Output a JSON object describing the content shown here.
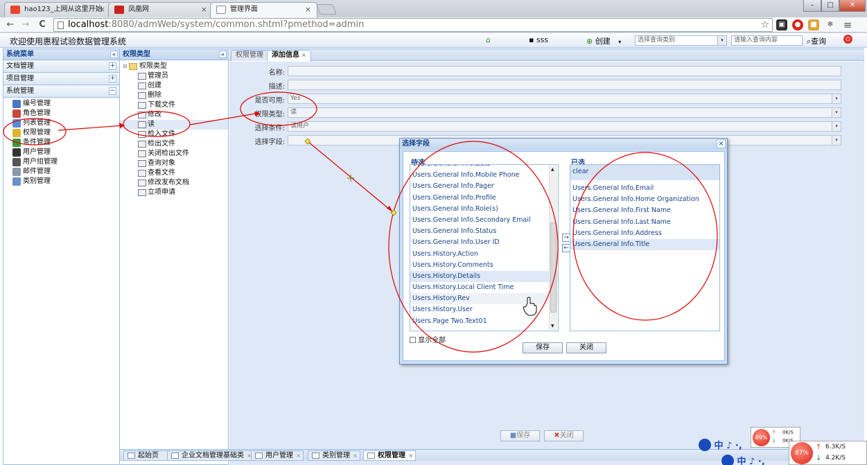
{
  "browser": {
    "tabs": [
      {
        "label": "hao123_上网从这里开始",
        "close": "×"
      },
      {
        "label": "凤凰网",
        "close": "×"
      },
      {
        "label": "管理界面",
        "close": "×"
      }
    ],
    "url_host": "localhost",
    "url_rest": ":8080/admWeb/system/common.shtml?pmethod=admin",
    "nav": {
      "back": "←",
      "forward": "→",
      "reload": "C",
      "star": "☆",
      "menu": "≡"
    },
    "window": {
      "min": "–",
      "max": "□",
      "close": "✕"
    }
  },
  "header": {
    "title": "欢迎使用惠程试验数据管理系统",
    "user": "sss",
    "create": "创建",
    "category_placeholder": "选择查询类别",
    "search_placeholder": "请输入查询内容",
    "search_button": "查询"
  },
  "left_panel": {
    "title": "系统菜单",
    "collapse": "«",
    "sections": [
      {
        "label": "文档管理",
        "toggle": "+"
      },
      {
        "label": "项目管理",
        "toggle": "+"
      },
      {
        "label": "系统管理",
        "toggle": "−"
      }
    ],
    "items": [
      "编号管理",
      "角色管理",
      "列表管理",
      "权限管理",
      "条件管理",
      "用户管理",
      "用户组管理",
      "邮件管理",
      "类别管理"
    ]
  },
  "mid_panel": {
    "title": "权限类型",
    "collapse": "«",
    "root": "权限类型",
    "nodes": [
      "管理员",
      "创建",
      "删除",
      "下载文件",
      "修改",
      "读",
      "检入文件",
      "检出文件",
      "关闭检出文件",
      "查询对象",
      "查看文件",
      "修改发布文档",
      "立项申请"
    ]
  },
  "content": {
    "tabs": [
      {
        "label": "权限管理"
      },
      {
        "label": "添加信息",
        "close": "×"
      }
    ],
    "form": {
      "name_label": "名称:",
      "desc_label": "描述:",
      "enabled_label": "是否可用:",
      "enabled_value": "Yes",
      "type_label": "权限类型:",
      "type_value": "读",
      "cond_label": "选择条件:",
      "cond_value": "读用户",
      "field_label": "选择字段:"
    },
    "save": "保存",
    "close": "关闭"
  },
  "dialog": {
    "title": "选择字段",
    "close": "×",
    "available_title": "待选",
    "selected_title": "已选",
    "clear": "clear",
    "available": [
      "Users.General Info.Lists",
      "Users.General Info.Mobile Phone",
      "Users.General Info.Pager",
      "Users.General Info.Profile",
      "Users.General Info.Role(s)",
      "Users.General Info.Secondary Email",
      "Users.General Info.Status",
      "Users.General Info.User ID",
      "Users.History.Action",
      "Users.History.Comments",
      "Users.History.Details",
      "Users.History.Local Client Time",
      "Users.History.Rev",
      "Users.History.User",
      "Users.Page Two.Text01"
    ],
    "selected": [
      "Users.General Info.Email",
      "Users.General Info.Home Organization",
      "Users.General Info.First Name",
      "Users.General Info.Last Name",
      "Users.General Info.Address",
      "Users.General Info.Title"
    ],
    "add": "→",
    "remove": "←",
    "show_all": "显示全部",
    "save": "保存",
    "close_btn": "关闭"
  },
  "bottom_tabs": [
    "起始页",
    "企业文档管理基础类",
    "用户管理",
    "类别管理",
    "权限管理"
  ],
  "tray": {
    "ime1": "中 ♪ ·,",
    "ime2": "中 ♪ ·,",
    "pct_small": "89%",
    "pct_large": "87%",
    "up_small": "0K/S",
    "down_small": "0K/S",
    "up_large": "6.3K/S",
    "down_large": "4.2K/S",
    "up_arrow": "↑",
    "down_arrow": "↓"
  },
  "colors": {
    "accent": "#15428b",
    "panel_border": "#99bbe8",
    "annotation": "#e00000"
  }
}
